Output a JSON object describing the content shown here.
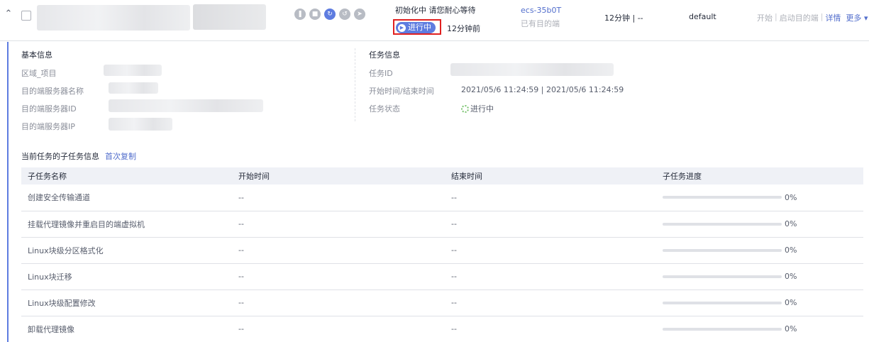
{
  "task_row": {
    "status_icons": [
      "pause-icon",
      "stop-icon",
      "sync-icon",
      "restart-icon",
      "launch-icon"
    ],
    "progress_hint": "初始化中  请您耐心等待",
    "status_tag": "进行中",
    "elapsed": "12分钟前",
    "target_server": "ecs-35b0T",
    "target_server_sub": "已有目的端",
    "duration": "12分钟 | --",
    "project": "default",
    "actions": {
      "start": "开始",
      "launch_target": "启动目的端",
      "detail": "详情",
      "more": "更多"
    }
  },
  "basic_info": {
    "title": "基本信息",
    "labels": [
      "区域_项目",
      "目的端服务器名称",
      "目的端服务器ID",
      "目的端服务器IP"
    ]
  },
  "task_info": {
    "title": "任务信息",
    "id_label": "任务ID",
    "time_label": "开始时间/结束时间",
    "time_value": "2021/05/6 11:24:59 | 2021/05/6 11:24:59",
    "status_label": "任务状态",
    "status_value": "进行中"
  },
  "subtasks": {
    "title": "当前任务的子任务信息",
    "copy_link": "首次复制",
    "columns": [
      "子任务名称",
      "开始时间",
      "结束时间",
      "子任务进度"
    ],
    "rows": [
      {
        "name": "创建安全传输通道",
        "start": "--",
        "end": "--",
        "progress_pct": 0,
        "progress_text": "0%"
      },
      {
        "name": "挂载代理镜像并重启目的端虚拟机",
        "start": "--",
        "end": "--",
        "progress_pct": 0,
        "progress_text": "0%"
      },
      {
        "name": "Linux块级分区格式化",
        "start": "--",
        "end": "--",
        "progress_pct": 0,
        "progress_text": "0%"
      },
      {
        "name": "Linux块迁移",
        "start": "--",
        "end": "--",
        "progress_pct": 0,
        "progress_text": "0%"
      },
      {
        "name": "Linux块级配置修改",
        "start": "--",
        "end": "--",
        "progress_pct": 0,
        "progress_text": "0%"
      },
      {
        "name": "卸载代理镜像",
        "start": "--",
        "end": "--",
        "progress_pct": 0,
        "progress_text": "0%"
      }
    ]
  },
  "colors": {
    "accent": "#5e7ce0",
    "link": "#526ecc",
    "highlight": "#e02020",
    "running": "#7ac36f"
  }
}
